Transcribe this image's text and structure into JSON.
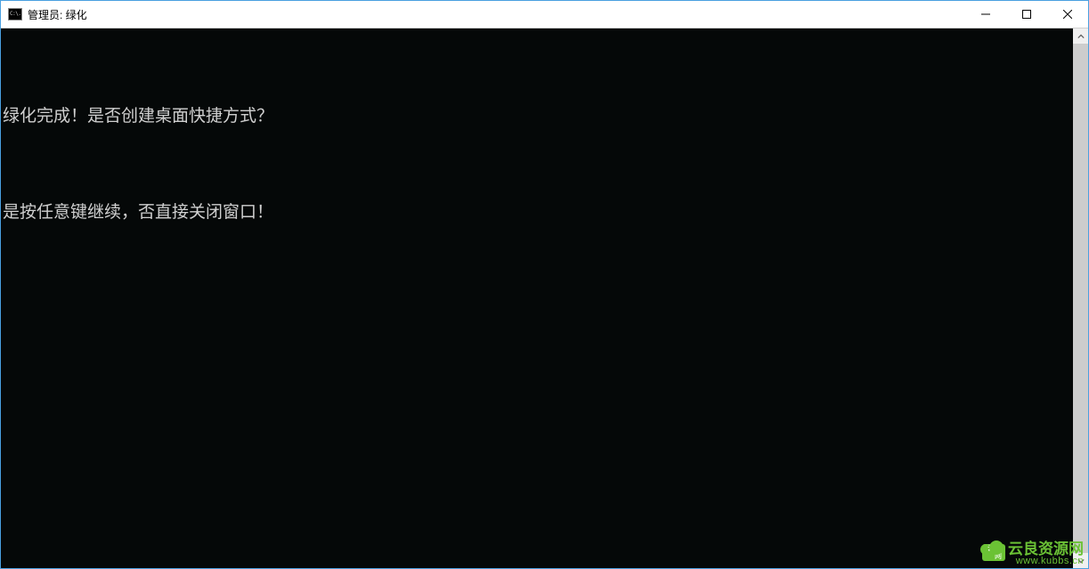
{
  "window": {
    "title": "管理员: 绿化",
    "icon_label": "C:\\."
  },
  "console": {
    "lines": [
      "绿化完成！是否创建桌面快捷方式？",
      "是按任意键继续，否直接关闭窗口！"
    ]
  },
  "watermark": {
    "badge": "云良网",
    "text": "云良资源网",
    "url": "www.kubbs.cn"
  }
}
